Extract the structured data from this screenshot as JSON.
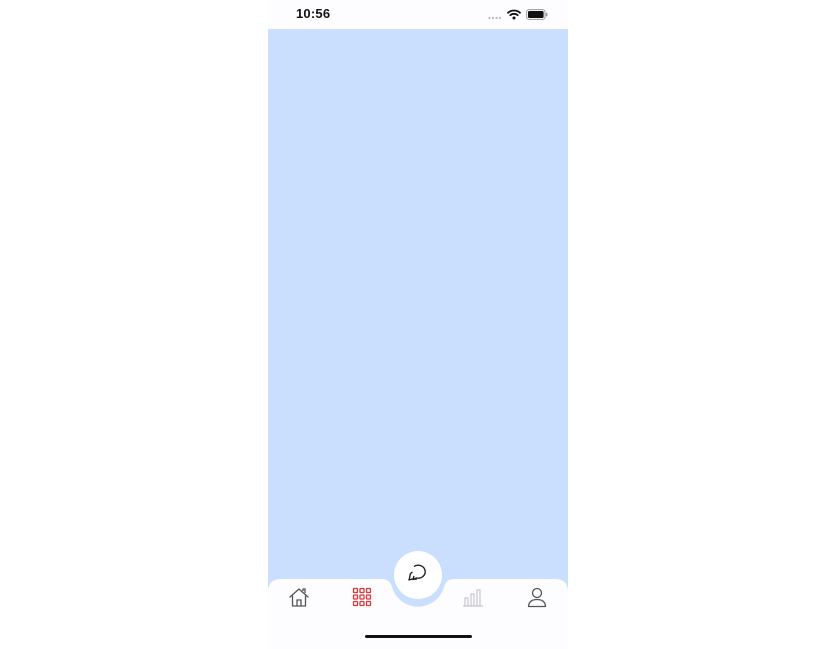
{
  "status_bar": {
    "time": "10:56",
    "icons": [
      "signal-icon",
      "wifi-icon",
      "battery-icon"
    ]
  },
  "content": {
    "background": "#c9dffd"
  },
  "tab_bar": {
    "background": "#fdfcfe",
    "active_color": "#d9373b",
    "inactive_color": "#555555",
    "disabled_color": "#c8c8cc",
    "items": [
      {
        "icon": "home-icon",
        "state": "inactive"
      },
      {
        "icon": "apps-grid-icon",
        "state": "active"
      },
      {
        "icon": "chat-icon",
        "state": "center"
      },
      {
        "icon": "bar-chart-icon",
        "state": "disabled"
      },
      {
        "icon": "profile-icon",
        "state": "inactive"
      }
    ]
  }
}
